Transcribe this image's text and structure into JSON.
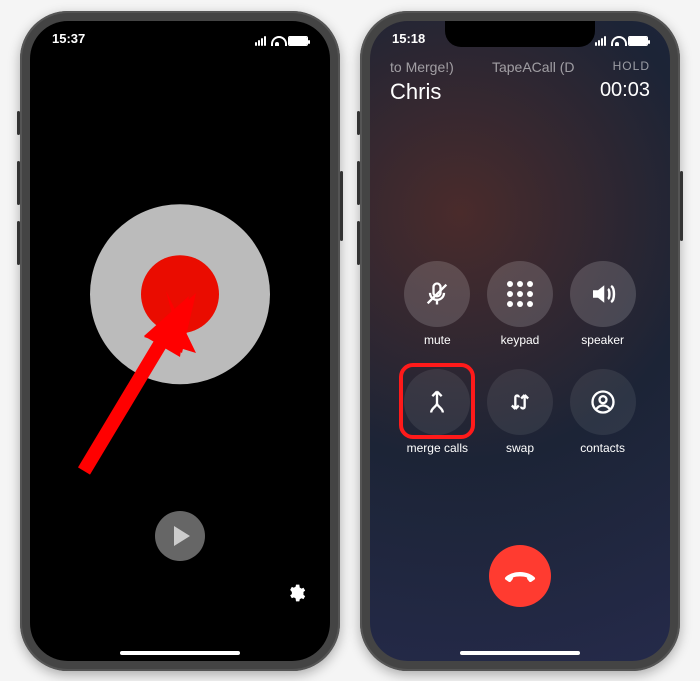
{
  "left": {
    "time": "15:37",
    "recordName": "record-button",
    "playName": "play-button",
    "settingsName": "settings-button"
  },
  "right": {
    "time": "15:18",
    "topLeft": "to Merge!)",
    "topMid": "TapeACall (D",
    "holdLabel": "HOLD",
    "callerName": "Chris",
    "duration": "00:03",
    "controls": {
      "mute": "mute",
      "keypad": "keypad",
      "speaker": "speaker",
      "merge": "merge calls",
      "swap": "swap",
      "contacts": "contacts"
    }
  }
}
